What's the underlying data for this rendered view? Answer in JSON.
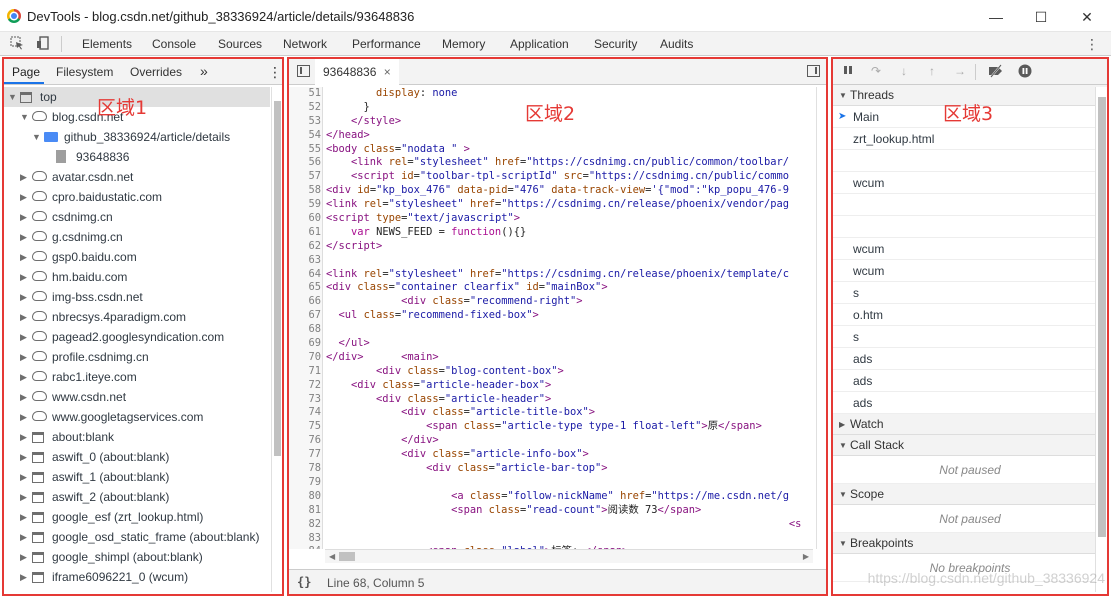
{
  "window": {
    "title": "DevTools - blog.csdn.net/github_38336924/article/details/93648836",
    "minimize": "—",
    "maximize": "☐",
    "close": "✕"
  },
  "main_tabs": [
    "Elements",
    "Console",
    "Sources",
    "Network",
    "Performance",
    "Memory",
    "Application",
    "Security",
    "Audits"
  ],
  "navigator": {
    "tabs": [
      "Page",
      "Filesystem",
      "Overrides"
    ],
    "more": "»",
    "region_label": "区域1",
    "tree": [
      {
        "label": "top",
        "type": "frame",
        "depth": 0,
        "open": true
      },
      {
        "label": "blog.csdn.net",
        "type": "cloud",
        "depth": 1,
        "open": true
      },
      {
        "label": "github_38336924/article/details",
        "type": "folder",
        "depth": 2,
        "open": true
      },
      {
        "label": "93648836",
        "type": "file",
        "depth": 3
      },
      {
        "label": "avatar.csdn.net",
        "type": "cloud",
        "depth": 1
      },
      {
        "label": "cpro.baidustatic.com",
        "type": "cloud",
        "depth": 1
      },
      {
        "label": "csdnimg.cn",
        "type": "cloud",
        "depth": 1
      },
      {
        "label": "g.csdnimg.cn",
        "type": "cloud",
        "depth": 1
      },
      {
        "label": "gsp0.baidu.com",
        "type": "cloud",
        "depth": 1
      },
      {
        "label": "hm.baidu.com",
        "type": "cloud",
        "depth": 1
      },
      {
        "label": "img-bss.csdn.net",
        "type": "cloud",
        "depth": 1
      },
      {
        "label": "nbrecsys.4paradigm.com",
        "type": "cloud",
        "depth": 1
      },
      {
        "label": "pagead2.googlesyndication.com",
        "type": "cloud",
        "depth": 1
      },
      {
        "label": "profile.csdnimg.cn",
        "type": "cloud",
        "depth": 1
      },
      {
        "label": "rabc1.iteye.com",
        "type": "cloud",
        "depth": 1
      },
      {
        "label": "www.csdn.net",
        "type": "cloud",
        "depth": 1
      },
      {
        "label": "www.googletagservices.com",
        "type": "cloud",
        "depth": 1
      },
      {
        "label": "about:blank",
        "type": "frame",
        "depth": 1
      },
      {
        "label": "aswift_0 (about:blank)",
        "type": "frame",
        "depth": 1
      },
      {
        "label": "aswift_1 (about:blank)",
        "type": "frame",
        "depth": 1
      },
      {
        "label": "aswift_2 (about:blank)",
        "type": "frame",
        "depth": 1
      },
      {
        "label": "google_esf (zrt_lookup.html)",
        "type": "frame",
        "depth": 1
      },
      {
        "label": "google_osd_static_frame (about:blank)",
        "type": "frame",
        "depth": 1
      },
      {
        "label": "google_shimpl (about:blank)",
        "type": "frame",
        "depth": 1
      },
      {
        "label": "iframe6096221_0 (wcum)",
        "type": "frame",
        "depth": 1
      }
    ]
  },
  "editor": {
    "file_tab": "93648836",
    "file_tab_close": "×",
    "region_label": "区域2",
    "status": "Line 68, Column 5",
    "status_icon": "{}",
    "lines": [
      {
        "n": "51",
        "html": "        <span class='a'>display</span>: <span class='v'>none</span>"
      },
      {
        "n": "52",
        "html": "      }"
      },
      {
        "n": "53",
        "html": "    <span class='t'>&lt;/style&gt;</span>"
      },
      {
        "n": "54",
        "html": "<span class='t'>&lt;/head&gt;</span>"
      },
      {
        "n": "55",
        "html": "<span class='t'>&lt;body</span> <span class='a'>class</span>=<span class='v'>\"nodata \"</span> <span class='t'>&gt;</span>"
      },
      {
        "n": "56",
        "html": "    <span class='t'>&lt;link</span> <span class='a'>rel</span>=<span class='v'>\"stylesheet\"</span> <span class='a'>href</span>=<span class='v'>\"https://csdnimg.cn/public/common/toolbar/</span>"
      },
      {
        "n": "57",
        "html": "    <span class='t'>&lt;script</span> <span class='a'>id</span>=<span class='v'>\"toolbar-tpl-scriptId\"</span> <span class='a'>src</span>=<span class='v'>\"https://csdnimg.cn/public/commo</span>"
      },
      {
        "n": "58",
        "html": "<span class='t'>&lt;div</span> <span class='a'>id</span>=<span class='v'>\"kp_box_476\"</span> <span class='a'>data-pid</span>=<span class='v'>\"476\"</span> <span class='a'>data-track-view</span>=<span class='v'>'{\"mod\":\"kp_popu_476-9</span>"
      },
      {
        "n": "59",
        "html": "<span class='t'>&lt;link</span> <span class='a'>rel</span>=<span class='v'>\"stylesheet\"</span> <span class='a'>href</span>=<span class='v'>\"https://csdnimg.cn/release/phoenix/vendor/pag</span>"
      },
      {
        "n": "60",
        "html": "<span class='t'>&lt;script</span> <span class='a'>type</span>=<span class='v'>\"text/javascript\"</span><span class='t'>&gt;</span>"
      },
      {
        "n": "61",
        "html": "    <span class='k'>var</span> NEWS_FEED = <span class='k'>function</span>(){}"
      },
      {
        "n": "62",
        "html": "<span class='t'>&lt;/script&gt;</span>"
      },
      {
        "n": "63",
        "html": ""
      },
      {
        "n": "64",
        "html": "<span class='t'>&lt;link</span> <span class='a'>rel</span>=<span class='v'>\"stylesheet\"</span> <span class='a'>href</span>=<span class='v'>\"https://csdnimg.cn/release/phoenix/template/c</span>"
      },
      {
        "n": "65",
        "html": "<span class='t'>&lt;div</span> <span class='a'>class</span>=<span class='v'>\"container clearfix\"</span> <span class='a'>id</span>=<span class='v'>\"mainBox\"</span><span class='t'>&gt;</span>"
      },
      {
        "n": "66",
        "html": "            <span class='t'>&lt;div</span> <span class='a'>class</span>=<span class='v'>\"recommend-right\"</span><span class='t'>&gt;</span>"
      },
      {
        "n": "67",
        "html": "  <span class='t'>&lt;ul</span> <span class='a'>class</span>=<span class='v'>\"recommend-fixed-box\"</span><span class='t'>&gt;</span>"
      },
      {
        "n": "68",
        "html": ""
      },
      {
        "n": "69",
        "html": "  <span class='t'>&lt;/ul&gt;</span>"
      },
      {
        "n": "70",
        "html": "<span class='t'>&lt;/div&gt;</span>      <span class='t'>&lt;main&gt;</span>"
      },
      {
        "n": "71",
        "html": "        <span class='t'>&lt;div</span> <span class='a'>class</span>=<span class='v'>\"blog-content-box\"</span><span class='t'>&gt;</span>"
      },
      {
        "n": "72",
        "html": "    <span class='t'>&lt;div</span> <span class='a'>class</span>=<span class='v'>\"article-header-box\"</span><span class='t'>&gt;</span>"
      },
      {
        "n": "73",
        "html": "        <span class='t'>&lt;div</span> <span class='a'>class</span>=<span class='v'>\"article-header\"</span><span class='t'>&gt;</span>"
      },
      {
        "n": "74",
        "html": "            <span class='t'>&lt;div</span> <span class='a'>class</span>=<span class='v'>\"article-title-box\"</span><span class='t'>&gt;</span>"
      },
      {
        "n": "75",
        "html": "                <span class='t'>&lt;span</span> <span class='a'>class</span>=<span class='v'>\"article-type type-1 float-left\"</span><span class='t'>&gt;</span>原<span class='t'>&lt;/span&gt;</span>"
      },
      {
        "n": "76",
        "html": "            <span class='t'>&lt;/div&gt;</span>"
      },
      {
        "n": "77",
        "html": "            <span class='t'>&lt;div</span> <span class='a'>class</span>=<span class='v'>\"article-info-box\"</span><span class='t'>&gt;</span>"
      },
      {
        "n": "78",
        "html": "                <span class='t'>&lt;div</span> <span class='a'>class</span>=<span class='v'>\"article-bar-top\"</span><span class='t'>&gt;</span>"
      },
      {
        "n": "79",
        "html": ""
      },
      {
        "n": "80",
        "html": "                    <span class='t'>&lt;a</span> <span class='a'>class</span>=<span class='v'>\"follow-nickName\"</span> <span class='a'>href</span>=<span class='v'>\"https://me.csdn.net/g</span>"
      },
      {
        "n": "81",
        "html": "                    <span class='t'>&lt;span</span> <span class='a'>class</span>=<span class='v'>\"read-count\"</span><span class='t'>&gt;</span>阅读数 73<span class='t'>&lt;/span&gt;</span>"
      },
      {
        "n": "82",
        "html": "                                                                          <span class='t'>&lt;s</span>"
      },
      {
        "n": "83",
        "html": ""
      },
      {
        "n": "84",
        "html": "                <span class='t'>&lt;span</span> <span class='a'>class</span>=<span class='v'>\"label\"</span><span class='t'>&gt;</span>标签: <span class='t'>&lt;/span&gt;</span>"
      }
    ]
  },
  "debugger": {
    "region_label": "区域3",
    "threads_title": "Threads",
    "threads": [
      "Main",
      "zrt_lookup.html",
      "",
      "wcum",
      "",
      "",
      "wcum",
      "wcum",
      "s",
      "o.htm",
      "s",
      "ads",
      "ads",
      "ads"
    ],
    "watch_title": "Watch",
    "callstack_title": "Call Stack",
    "callstack_empty": "Not paused",
    "scope_title": "Scope",
    "scope_empty": "Not paused",
    "breakpoints_title": "Breakpoints",
    "breakpoints_empty": "No breakpoints"
  },
  "watermark": "https://blog.csdn.net/github_38336924",
  "colors": {
    "highlight": "#e53935",
    "accent": "#1a73e8"
  }
}
